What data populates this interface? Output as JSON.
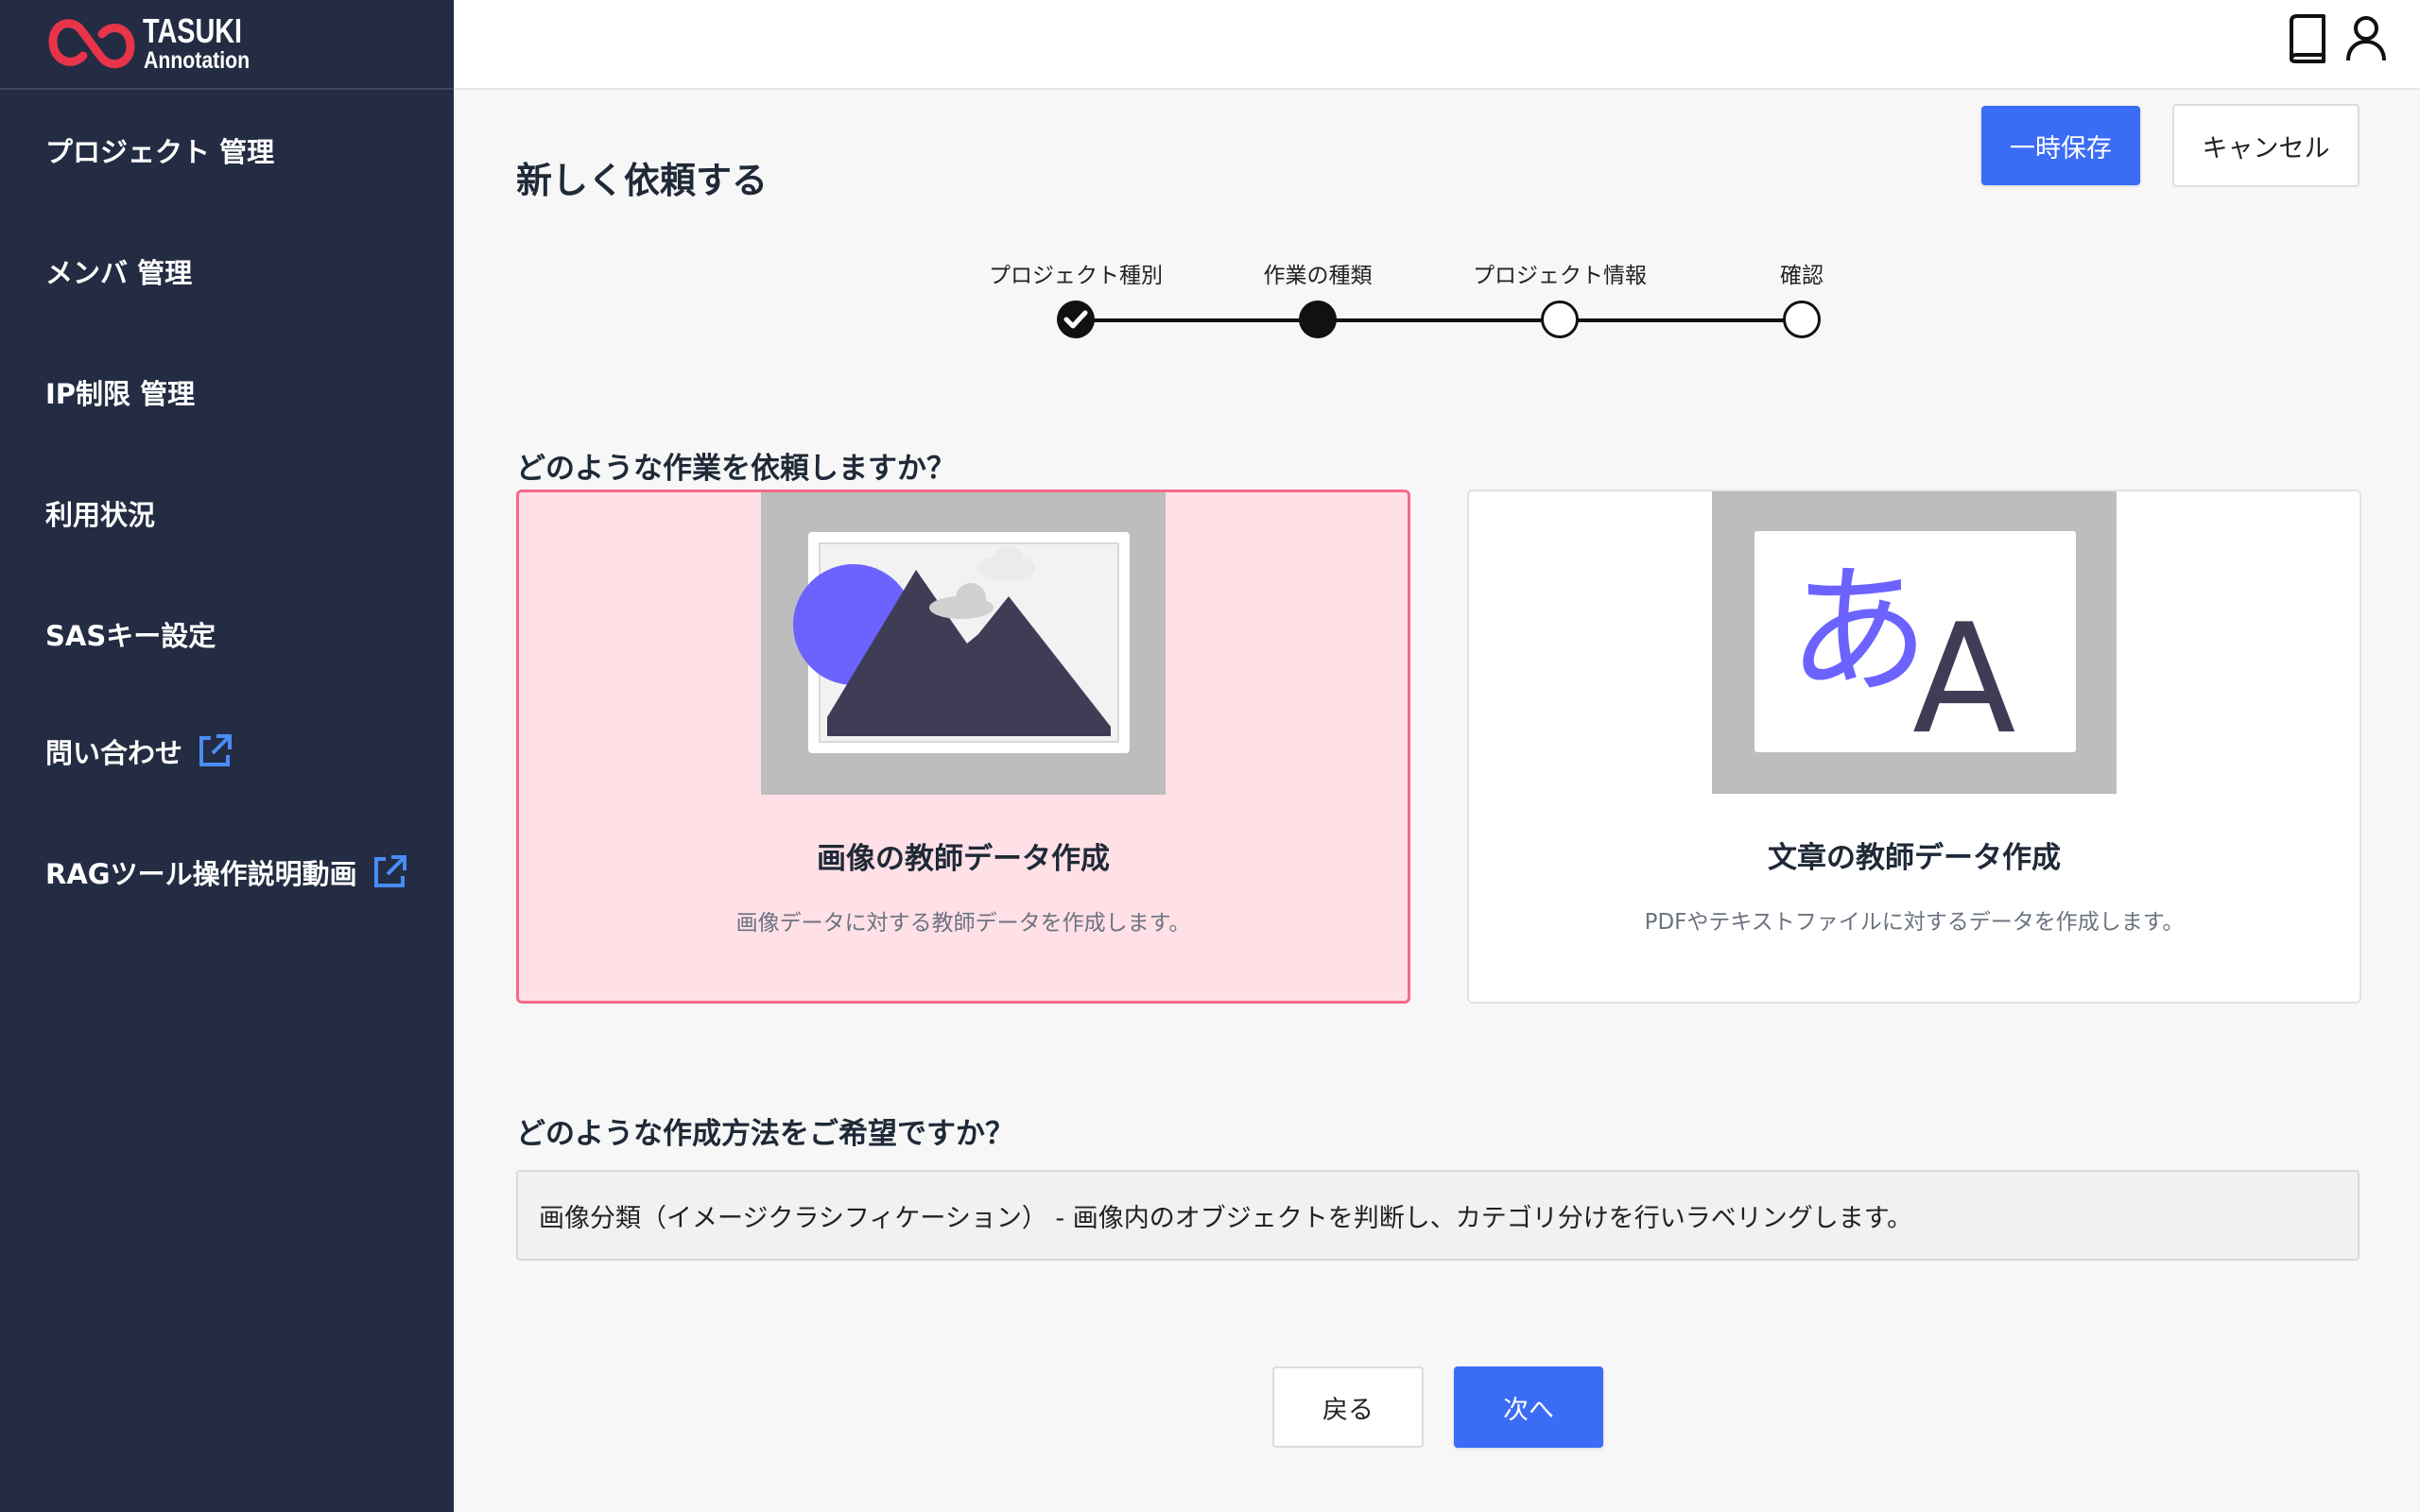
{
  "brand": {
    "name": "TASUKI",
    "subtitle": "Annotation",
    "accent": "#e8344a"
  },
  "sidebar": {
    "items": [
      {
        "label": "プロジェクト 管理",
        "external": false
      },
      {
        "label": "メンバ 管理",
        "external": false
      },
      {
        "label": "IP制限 管理",
        "external": false
      },
      {
        "label": "利用状況",
        "external": false
      },
      {
        "label": "SASキー設定",
        "external": false
      },
      {
        "label": "問い合わせ",
        "external": true
      },
      {
        "label": "RAGツール操作説明動画",
        "external": true
      }
    ]
  },
  "header": {
    "icons": [
      "book-icon",
      "user-icon"
    ]
  },
  "page": {
    "title": "新しく依頼する",
    "save_label": "一時保存",
    "cancel_label": "キャンセル"
  },
  "stepper": {
    "steps": [
      {
        "label": "プロジェクト種別",
        "state": "done"
      },
      {
        "label": "作業の種類",
        "state": "current"
      },
      {
        "label": "プロジェクト情報",
        "state": "pending"
      },
      {
        "label": "確認",
        "state": "pending"
      }
    ]
  },
  "question1": "どのような作業を依頼しますか？",
  "cards": [
    {
      "title": "画像の教師データ作成",
      "desc": "画像データに対する教師データを作成します。",
      "selected": true,
      "icon": "image-illustration-icon"
    },
    {
      "title": "文章の教師データ作成",
      "desc": "PDFやテキストファイルに対するデータを作成します。",
      "selected": false,
      "icon": "text-language-icon",
      "glyph_ja": "あ",
      "glyph_en": "A"
    }
  ],
  "question2": "どのような作成方法をご希望ですか？",
  "method_value": "画像分類（イメージクラシフィケーション） - 画像内のオブジェクトを判断し、カテゴリ分けを行いラベリングします。",
  "footer": {
    "back_label": "戻る",
    "next_label": "次へ"
  },
  "colors": {
    "sidebar_bg": "#232c42",
    "primary": "#3b6cf5",
    "selected_card_bg": "#ffe0e6",
    "selected_card_border": "#f46a8a",
    "illustration_purple": "#6c63ff",
    "illustration_dark": "#3f3d56"
  }
}
